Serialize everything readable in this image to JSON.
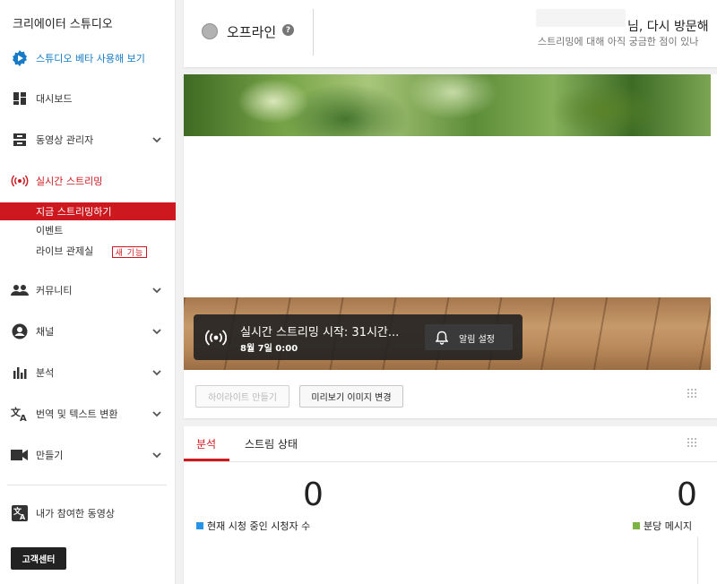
{
  "sidebar": {
    "app_title": "크리에이터 스튜디오",
    "beta_label": "스튜디오 베타 사용해 보기",
    "items": [
      {
        "label": "대시보드"
      },
      {
        "label": "동영상 관리자"
      },
      {
        "label": "실시간 스트리밍"
      },
      {
        "label": "커뮤니티"
      },
      {
        "label": "채널"
      },
      {
        "label": "분석"
      },
      {
        "label": "번역 및 텍스트 변환"
      },
      {
        "label": "만들기"
      }
    ],
    "live_sub": [
      {
        "label": "지금 스트리밍하기"
      },
      {
        "label": "이벤트"
      },
      {
        "label": "라이브 관제실"
      }
    ],
    "new_badge": "새 기능",
    "contributions": "내가 참여한 동영상",
    "help_button": "고객센터"
  },
  "top": {
    "status": "오프라인",
    "greeting": "님, 다시 방문해",
    "greeting_sub": "스트리밍에 대해 아직 궁금한 점이 있나"
  },
  "preview": {
    "notif_title": "실시간 스트리밍 시작: 31시간...",
    "notif_date": "8월 7일 0:00",
    "notif_button": "알림 설정",
    "highlight_button": "하이라이트 만들기",
    "thumbnail_button": "미리보기 이미지 변경"
  },
  "analytics": {
    "tabs": [
      {
        "label": "분석"
      },
      {
        "label": "스트림 상태"
      }
    ],
    "viewers_value": "0",
    "viewers_label": "현재 시청 중인 시청자 수",
    "chat_value": "0",
    "chat_label": "분당 메시지"
  },
  "colors": {
    "accent": "#cc181e",
    "link": "#167ac6",
    "viewers_swatch": "#2793e6",
    "chat_swatch": "#7cb342"
  }
}
